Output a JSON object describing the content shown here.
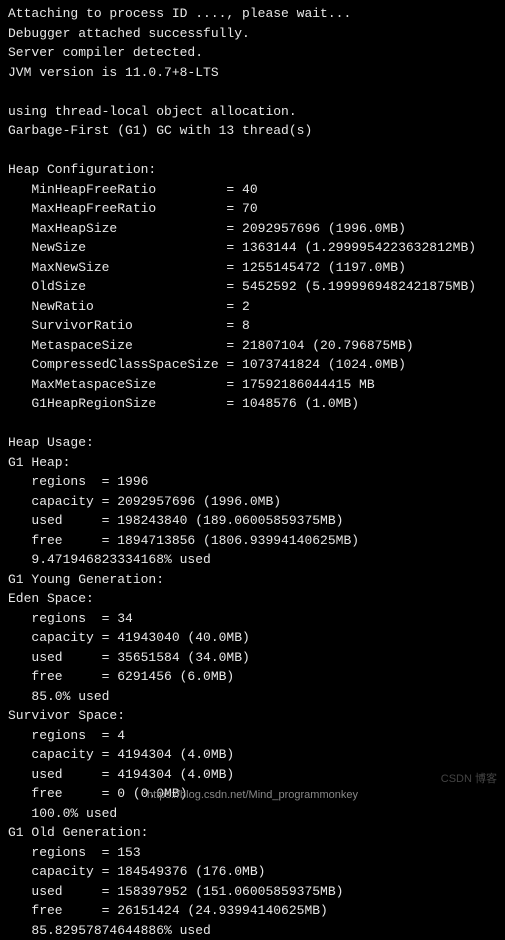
{
  "header": {
    "l0": "Attaching to process ID ...., please wait...",
    "l1": "Debugger attached successfully.",
    "l2": "Server compiler detected.",
    "l3": "JVM version is 11.0.7+8-LTS",
    "l4": "using thread-local object allocation.",
    "l5": "Garbage-First (G1) GC with 13 thread(s)"
  },
  "heapConfig": {
    "title": "Heap Configuration:",
    "rows": [
      {
        "k": "MinHeapFreeRatio",
        "v": "40"
      },
      {
        "k": "MaxHeapFreeRatio",
        "v": "70"
      },
      {
        "k": "MaxHeapSize",
        "v": "2092957696 (1996.0MB)"
      },
      {
        "k": "NewSize",
        "v": "1363144 (1.2999954223632812MB)"
      },
      {
        "k": "MaxNewSize",
        "v": "1255145472 (1197.0MB)"
      },
      {
        "k": "OldSize",
        "v": "5452592 (5.1999969482421875MB)"
      },
      {
        "k": "NewRatio",
        "v": "2"
      },
      {
        "k": "SurvivorRatio",
        "v": "8"
      },
      {
        "k": "MetaspaceSize",
        "v": "21807104 (20.796875MB)"
      },
      {
        "k": "CompressedClassSpaceSize",
        "v": "1073741824 (1024.0MB)"
      },
      {
        "k": "MaxMetaspaceSize",
        "v": "17592186044415 MB"
      },
      {
        "k": "G1HeapRegionSize",
        "v": "1048576 (1.0MB)"
      }
    ]
  },
  "heapUsage": {
    "title": "Heap Usage:",
    "g1heap": {
      "title": "G1 Heap:",
      "regions": "1996",
      "capacity": "2092957696 (1996.0MB)",
      "used": "198243840 (189.06005859375MB)",
      "free": "1894713856 (1806.93994140625MB)",
      "pct": "9.471946823334168% used"
    },
    "young": {
      "title": "G1 Young Generation:"
    },
    "eden": {
      "title": "Eden Space:",
      "regions": "34",
      "capacity": "41943040 (40.0MB)",
      "used": "35651584 (34.0MB)",
      "free": "6291456 (6.0MB)",
      "pct": "85.0% used"
    },
    "survivor": {
      "title": "Survivor Space:",
      "regions": "4",
      "capacity": "4194304 (4.0MB)",
      "used": "4194304 (4.0MB)",
      "free": "0 (0.0MB)",
      "pct": "100.0% used"
    },
    "old": {
      "title": "G1 Old Generation:",
      "regions": "153",
      "capacity": "184549376 (176.0MB)",
      "used": "158397952 (151.06005859375MB)",
      "free": "26151424 (24.93994140625MB)",
      "pct": "85.82957874644886% used"
    }
  },
  "labels": {
    "regions": "regions",
    "capacity": "capacity",
    "used": "used",
    "free": "free"
  },
  "watermark": "https://blog.csdn.net/Mind_programmonkey",
  "watermark_side": "CSDN 博客"
}
